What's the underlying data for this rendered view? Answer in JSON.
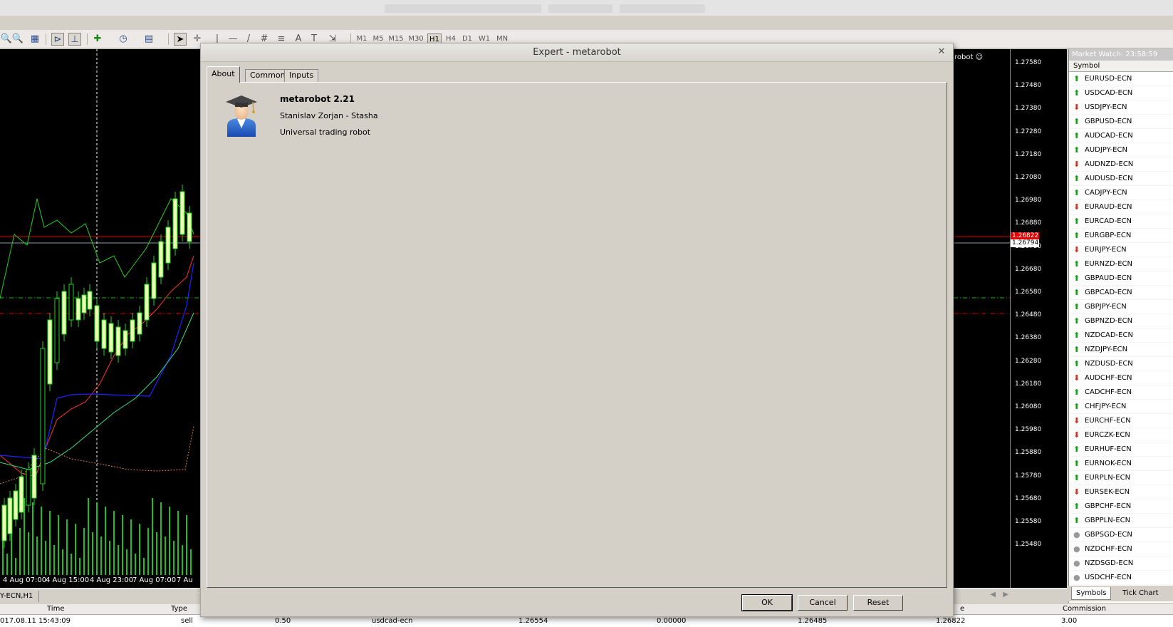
{
  "toolbar": {
    "timeframes": [
      "M1",
      "M5",
      "M15",
      "M30",
      "H1",
      "H4",
      "D1",
      "W1",
      "MN"
    ],
    "active_timeframe": "H1"
  },
  "chart": {
    "name": "metarobot ☺",
    "price_labels": [
      "1.27580",
      "1.27480",
      "1.27380",
      "1.27280",
      "1.27180",
      "1.27080",
      "1.26980",
      "1.26880",
      "1.26780",
      "1.26680",
      "1.26580",
      "1.26480",
      "1.26380",
      "1.26280",
      "1.26180",
      "1.26080",
      "1.25980",
      "1.25880",
      "1.25780",
      "1.25680",
      "1.25580",
      "1.25480"
    ],
    "current_ask": "1.26822",
    "current_bid": "1.26794",
    "time_labels": [
      "4 Aug 07:00",
      "4 Aug 15:00",
      "4 Aug 23:00",
      "7 Aug 07:00",
      "7 Au"
    ],
    "tab_label": "Y-ECN,H1"
  },
  "terminal": {
    "headers": [
      "Time",
      "Type",
      "e",
      "Commission"
    ],
    "row": [
      "017.08.11 15:43:09",
      "sell",
      "0.50",
      "usdcad-ecn",
      "1.26554",
      "0.00000",
      "1.26485",
      "1.26822",
      "3.00"
    ]
  },
  "market_watch": {
    "title": "Market Watch: 23:58:59",
    "column": "Symbol",
    "symbols": [
      {
        "name": "EURUSD-ECN",
        "dir": "up"
      },
      {
        "name": "USDCAD-ECN",
        "dir": "up"
      },
      {
        "name": "USDJPY-ECN",
        "dir": "down"
      },
      {
        "name": "GBPUSD-ECN",
        "dir": "up"
      },
      {
        "name": "AUDCAD-ECN",
        "dir": "up"
      },
      {
        "name": "AUDJPY-ECN",
        "dir": "up"
      },
      {
        "name": "AUDNZD-ECN",
        "dir": "down"
      },
      {
        "name": "AUDUSD-ECN",
        "dir": "up"
      },
      {
        "name": "CADJPY-ECN",
        "dir": "up"
      },
      {
        "name": "EURAUD-ECN",
        "dir": "down"
      },
      {
        "name": "EURCAD-ECN",
        "dir": "up"
      },
      {
        "name": "EURGBP-ECN",
        "dir": "up"
      },
      {
        "name": "EURJPY-ECN",
        "dir": "down"
      },
      {
        "name": "EURNZD-ECN",
        "dir": "up"
      },
      {
        "name": "GBPAUD-ECN",
        "dir": "up"
      },
      {
        "name": "GBPCAD-ECN",
        "dir": "up"
      },
      {
        "name": "GBPJPY-ECN",
        "dir": "up"
      },
      {
        "name": "GBPNZD-ECN",
        "dir": "up"
      },
      {
        "name": "NZDCAD-ECN",
        "dir": "up"
      },
      {
        "name": "NZDJPY-ECN",
        "dir": "up"
      },
      {
        "name": "NZDUSD-ECN",
        "dir": "up"
      },
      {
        "name": "AUDCHF-ECN",
        "dir": "down"
      },
      {
        "name": "CADCHF-ECN",
        "dir": "up"
      },
      {
        "name": "CHFJPY-ECN",
        "dir": "up"
      },
      {
        "name": "EURCHF-ECN",
        "dir": "down"
      },
      {
        "name": "EURCZK-ECN",
        "dir": "down"
      },
      {
        "name": "EURHUF-ECN",
        "dir": "up"
      },
      {
        "name": "EURNOK-ECN",
        "dir": "up"
      },
      {
        "name": "EURPLN-ECN",
        "dir": "up"
      },
      {
        "name": "EURSEK-ECN",
        "dir": "down"
      },
      {
        "name": "GBPCHF-ECN",
        "dir": "up"
      },
      {
        "name": "GBPPLN-ECN",
        "dir": "up"
      },
      {
        "name": "GBPSGD-ECN",
        "dir": "flat"
      },
      {
        "name": "NZDCHF-ECN",
        "dir": "flat"
      },
      {
        "name": "NZDSGD-ECN",
        "dir": "flat"
      },
      {
        "name": "USDCHF-ECN",
        "dir": "flat"
      }
    ],
    "tabs": [
      "Symbols",
      "Tick Chart"
    ]
  },
  "dialog": {
    "title": "Expert - metarobot",
    "tabs": [
      "About",
      "Common",
      "Inputs"
    ],
    "ea_name": "metarobot 2.21",
    "ea_author": "Stanislav Zorjan - Stasha",
    "ea_description": "Universal trading robot",
    "buttons": {
      "ok": "OK",
      "cancel": "Cancel",
      "reset": "Reset"
    }
  }
}
